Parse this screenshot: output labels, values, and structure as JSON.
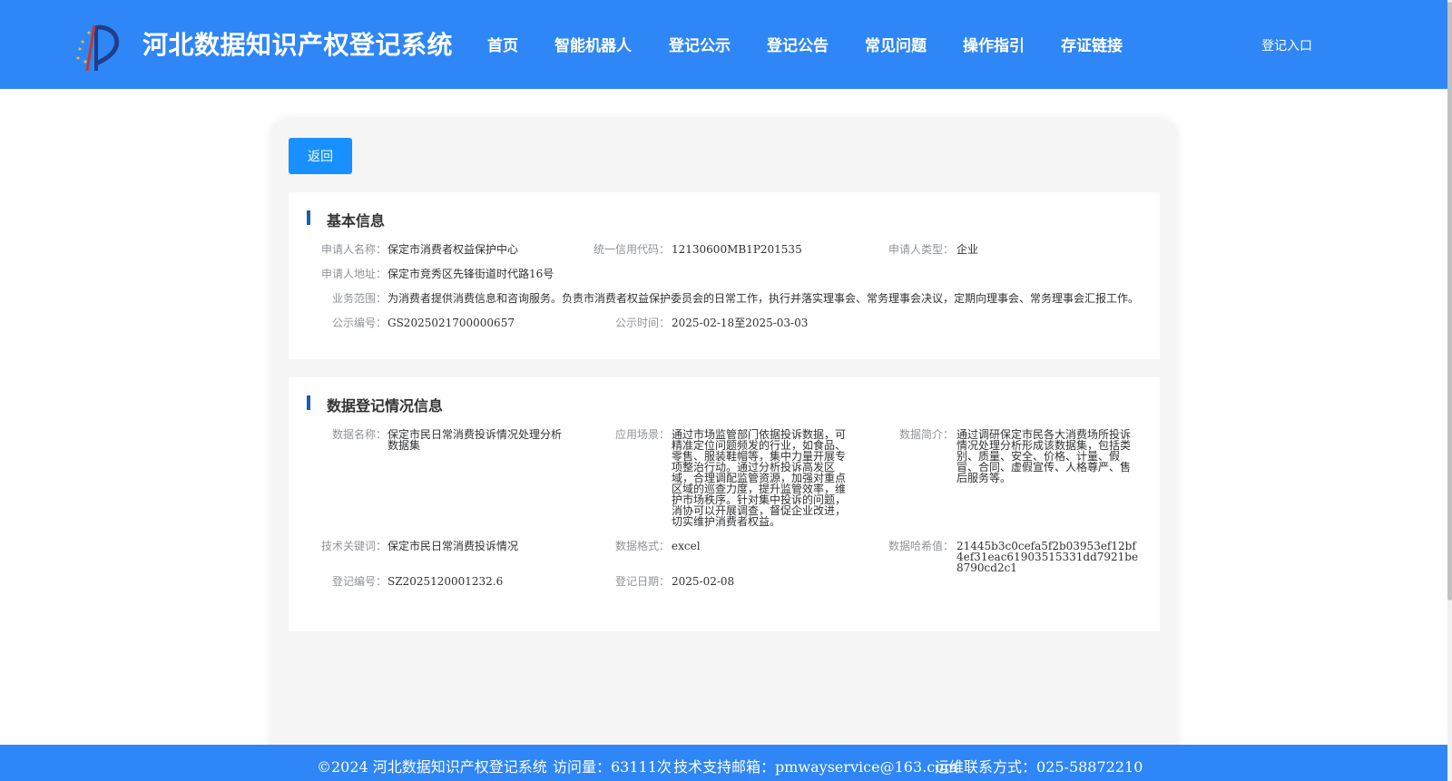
{
  "header": {
    "title": "河北数据知识产权登记系统",
    "nav": [
      "首页",
      "智能机器人",
      "登记公示",
      "登记公告",
      "常见问题",
      "操作指引",
      "存证链接"
    ],
    "login": "登记入口"
  },
  "back_label": "返回",
  "basic": {
    "title": "基本信息",
    "applicant_name_label": "申请人名称：",
    "applicant_name": "保定市消费者权益保护中心",
    "credit_code_label": "统一信用代码：",
    "credit_code": "12130600MB1P201535",
    "applicant_type_label": "申请人类型：",
    "applicant_type": "企业",
    "address_label": "申请人地址：",
    "address": "保定市竞秀区先锋街道时代路16号",
    "scope_label": "业务范围：",
    "scope": "为消费者提供消费信息和咨询服务。负责市消费者权益保护委员会的日常工作，执行并落实理事会、常务理事会决议，定期向理事会、常务理事会汇报工作。",
    "notice_no_label": "公示编号：",
    "notice_no": "GS2025021700000657",
    "notice_time_label": "公示时间：",
    "notice_time": "2025-02-18至2025-03-03"
  },
  "data": {
    "title": "数据登记情况信息",
    "name_label": "数据名称：",
    "name": "保定市民日常消费投诉情况处理分析数据集",
    "scene_label": "应用场景：",
    "scene": "通过市场监管部门依据投诉数据，可精准定位问题频发的行业，如食品、零售、服装鞋帽等，集中力量开展专项整治行动。通过分析投诉高发区域，合理调配监管资源，加强对重点区域的巡查力度，提升监管效率，维护市场秩序。针对集中投诉的问题，消协可以开展调查，督促企业改进，切实维护消费者权益。",
    "intro_label": "数据简介：",
    "intro": "通过调研保定市民各大消费场所投诉情况处理分析形成该数据集，包括类别、质量、安全、价格、计量、假冒、合同、虚假宣传、人格尊严、售后服务等。",
    "keywords_label": "技术关键词：",
    "keywords": "保定市民日常消费投诉情况",
    "format_label": "数据格式：",
    "format": "excel",
    "hash_label": "数据哈希值：",
    "hash": "21445b3c0cefa5f2b03953ef12bf4ef31eac61903515331dd7921be8790cd2c1",
    "reg_no_label": "登记编号：",
    "reg_no": "SZ2025120001232.6",
    "reg_date_label": "登记日期：",
    "reg_date": "2025-02-08"
  },
  "footer": {
    "copyright": "©2024 河北数据知识产权登记系统",
    "visits": "访问量：63111次",
    "email": "技术支持邮箱：pmwayservice@163.com",
    "contact": "运维联系方式：025-58872210"
  },
  "colors": {
    "header_bg": "#2f86f6",
    "button": "#1890ff",
    "section_bar": "#1a5fb4"
  }
}
